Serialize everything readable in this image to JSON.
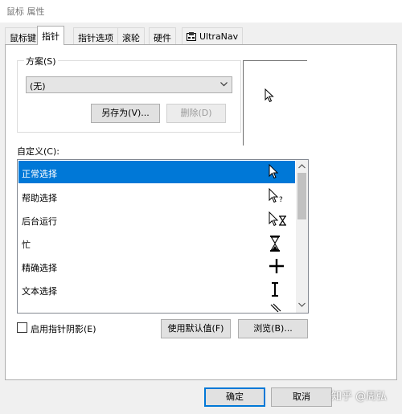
{
  "window": {
    "title": "鼠标 属性"
  },
  "tabs": [
    {
      "label": "鼠标键"
    },
    {
      "label": "指针"
    },
    {
      "label": "指针选项"
    },
    {
      "label": "滚轮"
    },
    {
      "label": "硬件"
    },
    {
      "label": "UltraNav"
    }
  ],
  "scheme": {
    "group_label": "方案(S)",
    "selected": "(无)",
    "save_as_label": "另存为(V)...",
    "delete_label": "删除(D)"
  },
  "customize": {
    "label": "自定义(C):",
    "items": [
      {
        "name": "正常选择",
        "icon": "arrow-cursor-icon",
        "selected": true
      },
      {
        "name": "帮助选择",
        "icon": "help-cursor-icon"
      },
      {
        "name": "后台运行",
        "icon": "working-in-background-cursor-icon"
      },
      {
        "name": "忙",
        "icon": "busy-hourglass-cursor-icon"
      },
      {
        "name": "精确选择",
        "icon": "crosshair-cursor-icon"
      },
      {
        "name": "文本选择",
        "icon": "text-ibeam-cursor-icon"
      }
    ]
  },
  "shadow_checkbox": {
    "label": "启用指针阴影(E)",
    "checked": false
  },
  "use_default_label": "使用默认值(F)",
  "browse_label": "浏览(B)...",
  "footer": {
    "ok_label": "确定",
    "cancel_label": "取消"
  },
  "watermark": "知乎 @周弘",
  "colors": {
    "selection": "#0078d7",
    "accent_border": "#0078d7"
  }
}
